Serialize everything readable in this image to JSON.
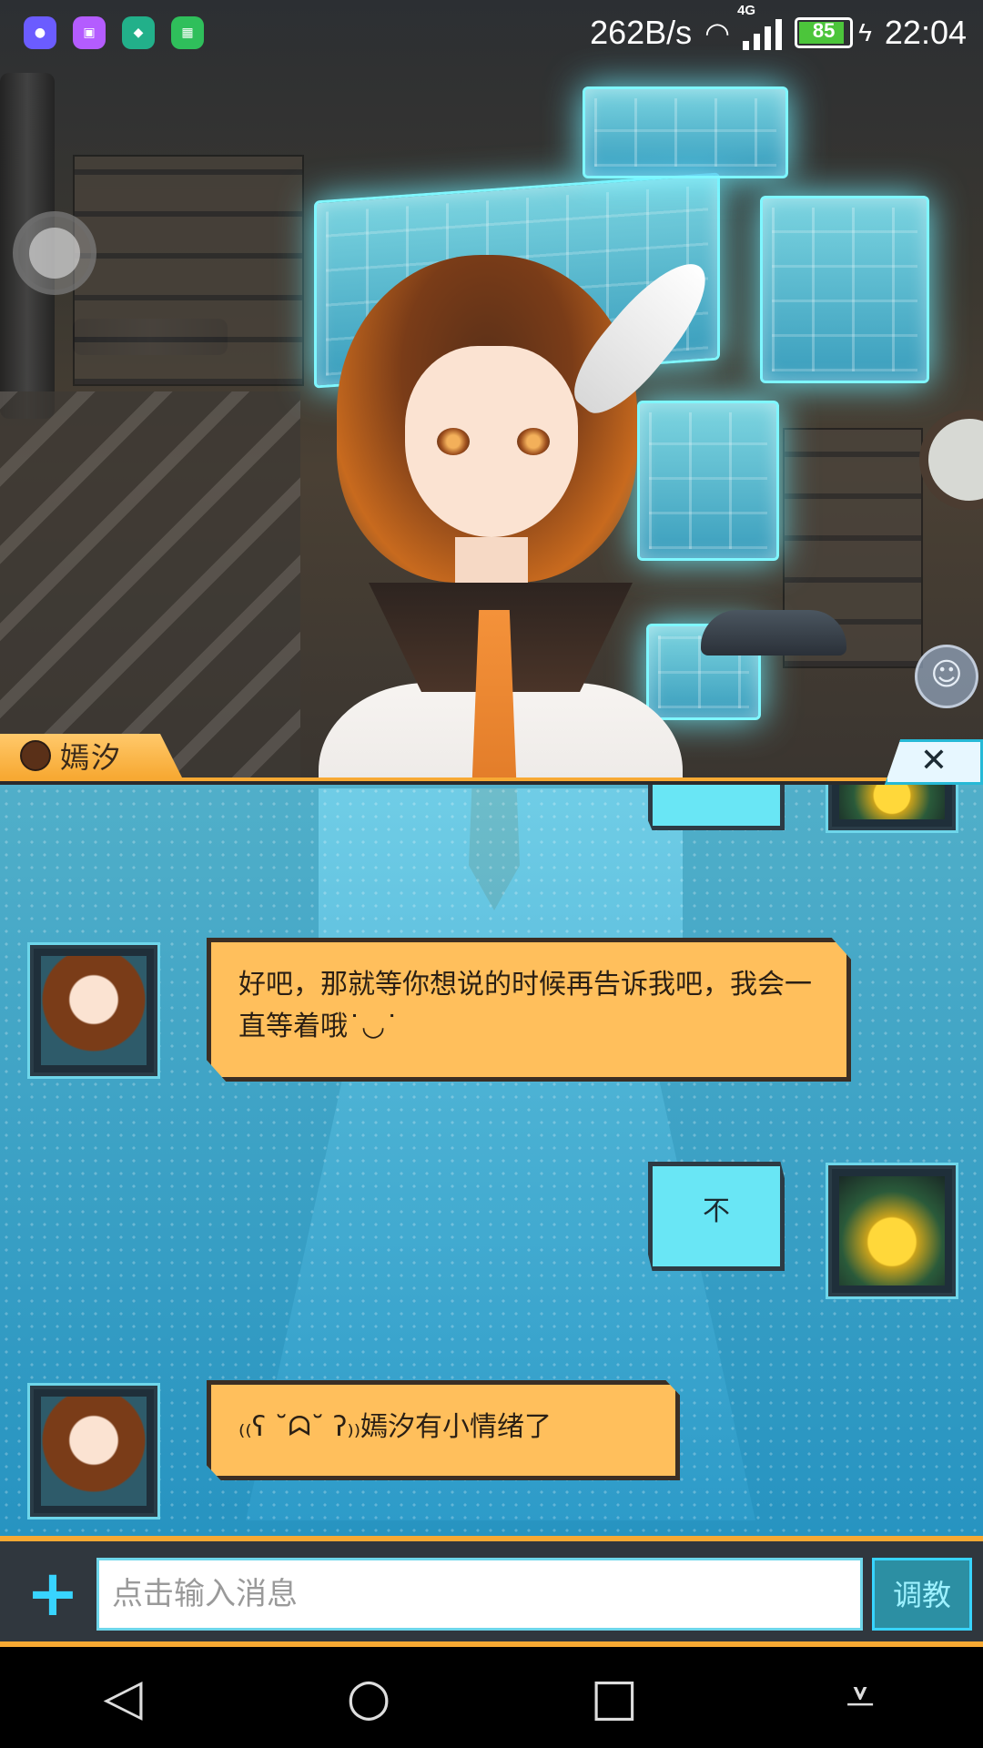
{
  "status_bar": {
    "net_speed": "262B/s",
    "network_type": "4G",
    "battery_level": "85",
    "time": "22:04",
    "notification_icons": [
      {
        "name": "app-icon-1",
        "color": "#6b5cff"
      },
      {
        "name": "image-icon",
        "color": "#b45cff"
      },
      {
        "name": "app-icon-2",
        "color": "#22b08a"
      },
      {
        "name": "grid-icon",
        "color": "#2fbf5b"
      }
    ]
  },
  "chat": {
    "bot_name": "嫣汐",
    "close_label": "✕",
    "messages": [
      {
        "from": "bot",
        "text": "好吧，那就等你想说的时候再告诉我吧，我会一直等着哦˙◡˙"
      },
      {
        "from": "user",
        "text": "不"
      },
      {
        "from": "bot",
        "text": "₍₍ʕ ˘ᗣ˘ ʔ₎₎嫣汐有小情绪了"
      }
    ]
  },
  "input": {
    "placeholder": "点击输入消息",
    "value": "",
    "plus_label": "+",
    "train_label": "调教"
  },
  "navbar": {
    "back_icon": "◁",
    "home_icon": "○",
    "recent_icon": "□",
    "menu_icon": "⩡"
  },
  "colors": {
    "accent_orange": "#f7a933",
    "accent_cyan": "#38d4ff",
    "bot_bubble": "#ffbf5c",
    "user_bubble": "#69e6f5"
  }
}
